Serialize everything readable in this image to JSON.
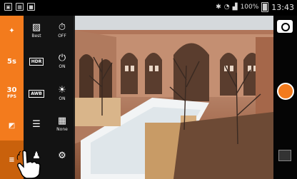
{
  "status_bar": {
    "icons_left": [
      "screenshot-icon",
      "image-icon",
      "bag-icon"
    ],
    "icons_right": [
      "bluetooth-icon",
      "wifi-icon",
      "signal-icon"
    ],
    "battery": "100%",
    "time": "13:43"
  },
  "left_rail": {
    "items": [
      {
        "icon": "magic-wand-icon",
        "label": ""
      },
      {
        "icon": "seconds-icon",
        "label": "5s"
      },
      {
        "icon": "fps-icon",
        "label": "30",
        "sublabel": "FPS"
      },
      {
        "icon": "exposure-icon",
        "label": ""
      },
      {
        "icon": "menu-icon",
        "label": ""
      }
    ]
  },
  "settings_panel": {
    "cells": [
      {
        "icon": "picture-icon",
        "label": "Best"
      },
      {
        "icon": "timer-icon",
        "label": "OFF"
      },
      {
        "icon": "hdr-icon",
        "glyph": "HDR",
        "label": ""
      },
      {
        "icon": "stabilizer-icon",
        "label": "ON"
      },
      {
        "icon": "awb-icon",
        "glyph": "AWB",
        "label": ""
      },
      {
        "icon": "sun-icon",
        "label": "ON"
      },
      {
        "icon": "sliders-icon",
        "label": ""
      },
      {
        "icon": "grid-icon",
        "label": "None"
      },
      {
        "icon": "person-icon",
        "label": ""
      },
      {
        "icon": "gear-icon",
        "label": ""
      }
    ]
  },
  "right_panel": {
    "camera_switch": "camera-switch-icon",
    "shutter": "shutter-button",
    "gallery": "gallery-thumbnail"
  },
  "colors": {
    "accent": "#f37b1d",
    "panel": "#141414",
    "statusbar": "#000000"
  }
}
